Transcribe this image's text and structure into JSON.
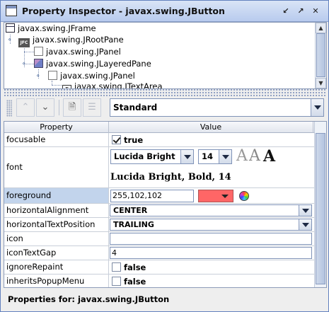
{
  "window": {
    "title": "Property Inspector - javax.swing.JButton"
  },
  "tree": {
    "nodes": [
      {
        "label": "javax.swing.JFrame",
        "icon": "frame-icon"
      },
      {
        "label": "javax.swing.JRootPane",
        "icon": "jfc-icon",
        "icon_text": "JFC"
      },
      {
        "label": "javax.swing.JPanel",
        "icon": "panel-icon"
      },
      {
        "label": "javax.swing.JLayeredPane",
        "icon": "layered-pane-icon"
      },
      {
        "label": "javax.swing.JPanel",
        "icon": "panel-icon"
      },
      {
        "label": "javax.swing.JTextArea",
        "icon": "textarea-icon"
      }
    ]
  },
  "toolbar": {
    "view_select": "Standard"
  },
  "table": {
    "headers": {
      "property": "Property",
      "value": "Value"
    },
    "rows": {
      "focusable": {
        "name": "focusable",
        "value": "true",
        "checked": true
      },
      "font": {
        "name": "font",
        "family": "Lucida Bright",
        "size": "14",
        "preview_chars": [
          "A",
          "A",
          "A"
        ],
        "preview_text": "Lucida Bright, Bold, 14"
      },
      "foreground": {
        "name": "foreground",
        "value": "255,102,102",
        "swatch_color": "#ff6666"
      },
      "horizontalAlignment": {
        "name": "horizontalAlignment",
        "value": "CENTER"
      },
      "horizontalTextPosition": {
        "name": "horizontalTextPosition",
        "value": "TRAILING"
      },
      "icon": {
        "name": "icon",
        "value": ""
      },
      "iconTextGap": {
        "name": "iconTextGap",
        "value": "4"
      },
      "ignoreRepaint": {
        "name": "ignoreRepaint",
        "value": "false",
        "checked": false
      },
      "inheritsPopupMenu": {
        "name": "inheritsPopupMenu",
        "value": "false",
        "checked": false
      }
    }
  },
  "status": {
    "text": "Properties for:  javax.swing.JButton"
  },
  "colors": {
    "title_bar": "#c6d5f0",
    "selection": "#c2d4ec",
    "swatch": "#ff6666"
  }
}
